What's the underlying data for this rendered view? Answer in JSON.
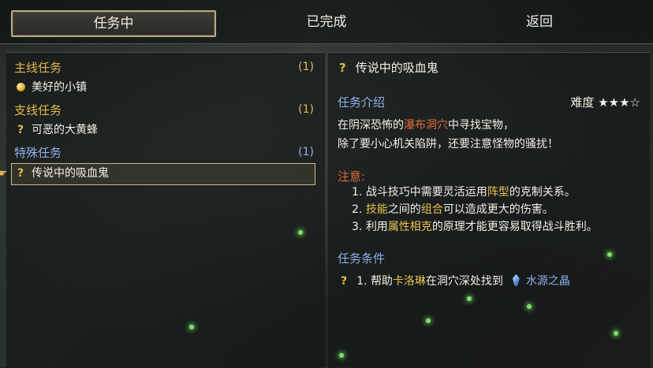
{
  "tabs": {
    "in_progress": "任务中",
    "completed": "已完成",
    "back": "返回"
  },
  "quest_list": {
    "main": {
      "title": "主线任务",
      "count": "(1)",
      "items": [
        "美好的小镇"
      ]
    },
    "side": {
      "title": "支线任务",
      "count": "(1)",
      "items": [
        "可恶的大黄蜂"
      ]
    },
    "special": {
      "title": "特殊任务",
      "count": "(1)",
      "items": [
        "传说中的吸血鬼"
      ]
    },
    "question_mark": "?"
  },
  "detail": {
    "title": "传说中的吸血鬼",
    "intro_label": "任务介绍",
    "difficulty_label": "难度",
    "difficulty_stars": "★★★☆",
    "desc_line1_a": "在阴深恐怖的",
    "desc_line1_hl": "瀑布洞穴",
    "desc_line1_b": "中寻找宝物，",
    "desc_line2": "除了要小心机关陷阱，还要注意怪物的骚扰！",
    "note_label": "注意:",
    "notes": [
      {
        "num": "1.",
        "a": "战斗技巧中需要灵活运用",
        "hl": "阵型",
        "b": "的克制关系。"
      },
      {
        "num": "2.",
        "hl1": "技能",
        "a": "之间的",
        "hl2": "组合",
        "b": "可以造成更大的伤害。"
      },
      {
        "num": "3.",
        "a": "利用",
        "hl": "属性相克",
        "b": "的原理才能更容易取得战斗胜利。"
      }
    ],
    "condition_label": "任务条件",
    "condition": {
      "num": "1.",
      "a": "帮助",
      "hl": "卡洛琳",
      "b": "在洞穴深处找到",
      "item": "水源之晶"
    }
  },
  "colors": {
    "gold": "#e1b94f",
    "blue": "#8fb0e8",
    "red": "#e06a3c"
  },
  "icons": [
    "question-mark-icon",
    "gold-coin-icon",
    "pointer-hand-icon",
    "crystal-icon",
    "star-icon"
  ]
}
